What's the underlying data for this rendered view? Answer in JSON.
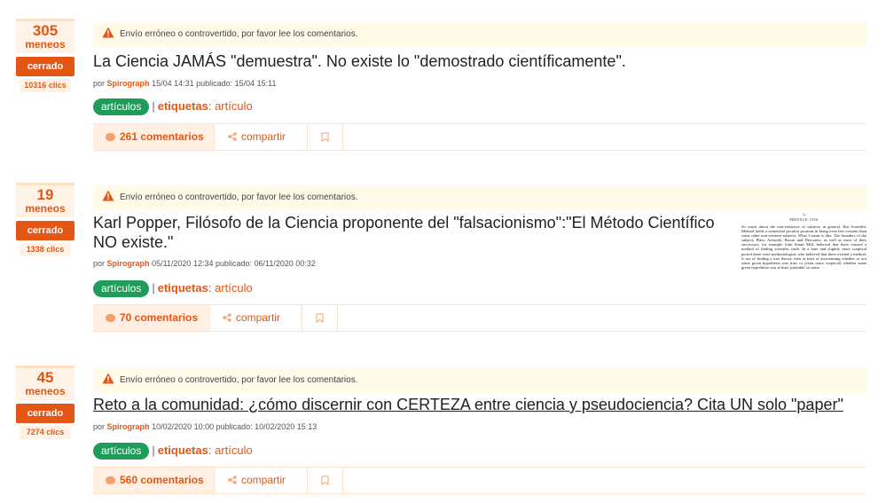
{
  "stories": [
    {
      "votes": "305",
      "votes_label": "meneos",
      "status": "cerrado",
      "clicks": "10316 clics",
      "warning": "Envío erróneo o controvertido, por favor lee los comentarios.",
      "title": "La Ciencia JAMÁS \"demuestra\". No existe lo \"demostrado científicamente\".",
      "meta_prefix": "por",
      "author": "Spirograph",
      "meta_dates": "15/04 14:31 publicado: 15/04 15:11",
      "category": "artículos",
      "tags_label": "etiquetas",
      "tags_value": "artículo",
      "comments": "261 comentarios",
      "share": "compartir"
    },
    {
      "votes": "19",
      "votes_label": "meneos",
      "status": "cerrado",
      "clicks": "1338 clics",
      "warning": "Envío erróneo o controvertido, por favor lee los comentarios.",
      "title": "Karl Popper, Filósofo de la Ciencia proponente del \"falsacionismo\":\"El Método Científico NO existe.\"",
      "meta_prefix": "por",
      "author": "Spirograph",
      "meta_dates": "05/11/2020 12:34 publicado: 06/11/2020 00:32",
      "category": "artículos",
      "tags_label": "etiquetas",
      "tags_value": "artículo",
      "comments": "70 comentarios",
      "share": "compartir",
      "thumbnail": {
        "number": "5",
        "heading": "PREFACE 1956",
        "text": "So much about the non-existence of subjects in general. But Scientific Method holds a somewhat peculiar position in being even less existent than some other non-existent subjects. What I mean is this. The founders of the subject, Plato, Aristotle, Bacon and Descartes, as well as most of their successors, for example John Stuart Mill, believed that there existed a method of finding scientific truth. In a later and slightly more sceptical period there were methodologists who believed that there existed a method, if not of finding a true theory, then at least of ascertaining whether or not some given hypothesis was true; or (even more sceptical) whether some given hypothesis was at least 'probable' to some"
      }
    },
    {
      "votes": "45",
      "votes_label": "meneos",
      "status": "cerrado",
      "clicks": "7274 clics",
      "warning": "Envío erróneo o controvertido, por favor lee los comentarios.",
      "title": "Reto a la comunidad: ¿cómo discernir con CERTEZA entre ciencia y pseudociencia? Cita UN solo \"paper\"",
      "meta_prefix": "por",
      "author": "Spirograph",
      "meta_dates": "10/02/2020 10:00 publicado: 10/02/2020 15:13",
      "category": "artículos",
      "tags_label": "etiquetas",
      "tags_value": "artículo",
      "comments": "560 comentarios",
      "share": "compartir"
    }
  ]
}
